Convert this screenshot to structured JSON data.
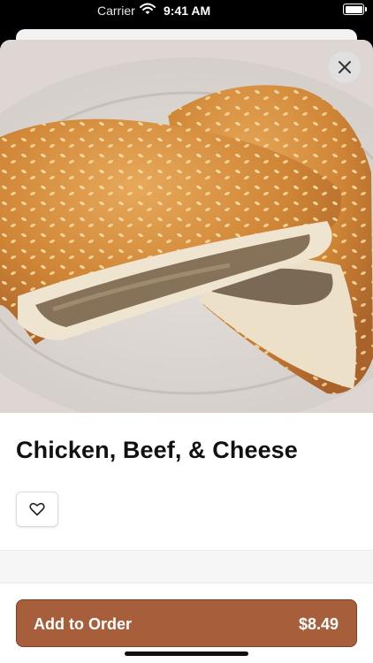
{
  "status_bar": {
    "carrier": "Carrier",
    "time": "9:41 AM",
    "wifi_icon": "wifi-icon",
    "battery_icon": "battery-icon"
  },
  "item": {
    "image_alt": "Chicken, Beef, & Cheese pastry",
    "title": "Chicken, Beef, & Cheese"
  },
  "actions": {
    "close_icon": "close-icon",
    "favorite_icon": "heart-icon",
    "add_label": "Add to Order",
    "price": "$8.49"
  },
  "colors": {
    "accent": "#a65f3a",
    "accent_border": "#7a4226"
  }
}
